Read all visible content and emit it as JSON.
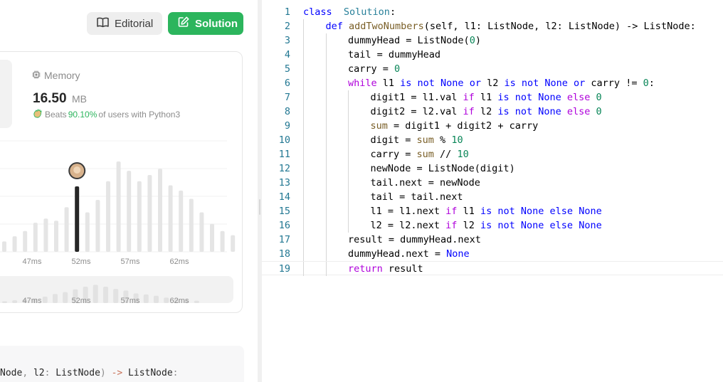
{
  "header": {
    "editorial_label": "Editorial",
    "solution_label": "Solution"
  },
  "memory": {
    "label": "Memory",
    "value": "16.50",
    "unit": "MB",
    "beats_prefix": "Beats",
    "beats_percent": "90.10%",
    "beats_suffix": "of users with Python3"
  },
  "colors": {
    "accent_green": "#2cb55d",
    "bar_gray": "#e5e5e5",
    "bar_selected": "#262626"
  },
  "chart_data": {
    "type": "bar",
    "title": "",
    "xlabel": "",
    "ylabel": "",
    "tick_labels": [
      "47ms",
      "52ms",
      "57ms",
      "62ms"
    ],
    "values": [
      0.1,
      0.15,
      0.2,
      0.28,
      0.32,
      0.3,
      0.43,
      0.63,
      0.38,
      0.5,
      0.68,
      0.87,
      0.78,
      0.68,
      0.74,
      0.8,
      0.64,
      0.59,
      0.51,
      0.38,
      0.27,
      0.2,
      0.16
    ],
    "selected_index": 7,
    "overview_values": [
      0.08,
      0.12,
      0.16,
      0.2,
      0.28,
      0.4,
      0.48,
      0.6,
      0.72,
      0.8,
      0.72,
      0.62,
      0.55,
      0.42,
      0.38,
      0.32,
      0.24,
      0.18,
      0.14,
      0.1
    ]
  },
  "snippet": {
    "parts": [
      "Node",
      ", ",
      "l2",
      ": ",
      "ListNode",
      ") ",
      "->",
      " ListNode",
      ":"
    ]
  },
  "code": {
    "line_numbers": [
      "1",
      "2",
      "3",
      "4",
      "5",
      "6",
      "7",
      "8",
      "9",
      "10",
      "11",
      "12",
      "13",
      "14",
      "15",
      "16",
      "17",
      "18",
      "19"
    ],
    "lines": [
      {
        "indent": 0,
        "tokens": [
          [
            "kw",
            "class"
          ],
          [
            "",
            "  "
          ],
          [
            "cls",
            "Solution"
          ],
          [
            "",
            ":"
          ]
        ]
      },
      {
        "indent": 1,
        "tokens": [
          [
            "kw",
            "def"
          ],
          [
            "",
            " "
          ],
          [
            "fn",
            "addTwoNumbers"
          ],
          [
            "",
            "(self, l1: ListNode, l2: ListNode) -> ListNode:"
          ]
        ]
      },
      {
        "indent": 2,
        "tokens": [
          [
            "",
            "dummyHead = ListNode("
          ],
          [
            "num",
            "0"
          ],
          [
            "",
            ")"
          ]
        ]
      },
      {
        "indent": 2,
        "tokens": [
          [
            "",
            "tail = dummyHead"
          ]
        ]
      },
      {
        "indent": 2,
        "tokens": [
          [
            "",
            "carry = "
          ],
          [
            "num",
            "0"
          ]
        ]
      },
      {
        "indent": 2,
        "tokens": [
          [
            "kw2",
            "while"
          ],
          [
            "",
            " l1 "
          ],
          [
            "kw",
            "is not None"
          ],
          [
            "",
            " "
          ],
          [
            "kw",
            "or"
          ],
          [
            "",
            " l2 "
          ],
          [
            "kw",
            "is not None"
          ],
          [
            "",
            " "
          ],
          [
            "kw",
            "or"
          ],
          [
            "",
            " carry != "
          ],
          [
            "num",
            "0"
          ],
          [
            "",
            ":"
          ]
        ]
      },
      {
        "indent": 3,
        "tokens": [
          [
            "",
            "digit1 = l1.val "
          ],
          [
            "kw2",
            "if"
          ],
          [
            "",
            " l1 "
          ],
          [
            "kw",
            "is not None"
          ],
          [
            "",
            " "
          ],
          [
            "kw2",
            "else"
          ],
          [
            "",
            " "
          ],
          [
            "num",
            "0"
          ]
        ]
      },
      {
        "indent": 3,
        "tokens": [
          [
            "",
            "digit2 = l2.val "
          ],
          [
            "kw2",
            "if"
          ],
          [
            "",
            " l2 "
          ],
          [
            "kw",
            "is not None"
          ],
          [
            "",
            " "
          ],
          [
            "kw2",
            "else"
          ],
          [
            "",
            " "
          ],
          [
            "num",
            "0"
          ]
        ]
      },
      {
        "indent": 3,
        "tokens": [
          [
            "fn",
            "sum"
          ],
          [
            "",
            " = digit1 + digit2 + carry"
          ]
        ]
      },
      {
        "indent": 3,
        "tokens": [
          [
            "",
            "digit = "
          ],
          [
            "fn",
            "sum"
          ],
          [
            "",
            " % "
          ],
          [
            "num",
            "10"
          ]
        ]
      },
      {
        "indent": 3,
        "tokens": [
          [
            "",
            "carry = "
          ],
          [
            "fn",
            "sum"
          ],
          [
            "",
            " // "
          ],
          [
            "num",
            "10"
          ]
        ]
      },
      {
        "indent": 3,
        "tokens": [
          [
            "",
            "newNode = ListNode(digit)"
          ]
        ]
      },
      {
        "indent": 3,
        "tokens": [
          [
            "",
            "tail.next = newNode"
          ]
        ]
      },
      {
        "indent": 3,
        "tokens": [
          [
            "",
            "tail = tail.next"
          ]
        ]
      },
      {
        "indent": 3,
        "tokens": [
          [
            "",
            "l1 = l1.next "
          ],
          [
            "kw2",
            "if"
          ],
          [
            "",
            " l1 "
          ],
          [
            "kw",
            "is"
          ],
          [
            "",
            " "
          ],
          [
            "kw",
            "not"
          ],
          [
            "",
            " "
          ],
          [
            "kw",
            "None"
          ],
          [
            "",
            " "
          ],
          [
            "kw",
            "else"
          ],
          [
            "",
            " "
          ],
          [
            "kw",
            "None"
          ]
        ]
      },
      {
        "indent": 3,
        "tokens": [
          [
            "",
            "l2 = l2.next "
          ],
          [
            "kw2",
            "if"
          ],
          [
            "",
            " l2 "
          ],
          [
            "kw",
            "is"
          ],
          [
            "",
            " "
          ],
          [
            "kw",
            "not"
          ],
          [
            "",
            " "
          ],
          [
            "kw",
            "None"
          ],
          [
            "",
            " "
          ],
          [
            "kw",
            "else"
          ],
          [
            "",
            " "
          ],
          [
            "kw",
            "None"
          ]
        ]
      },
      {
        "indent": 2,
        "tokens": [
          [
            "",
            "result = dummyHead.next"
          ]
        ]
      },
      {
        "indent": 2,
        "tokens": [
          [
            "",
            "dummyHead.next = "
          ],
          [
            "kw",
            "None"
          ]
        ]
      },
      {
        "indent": 2,
        "tokens": [
          [
            "kw2",
            "return"
          ],
          [
            "",
            " result"
          ]
        ]
      }
    ],
    "current_line": 18
  }
}
